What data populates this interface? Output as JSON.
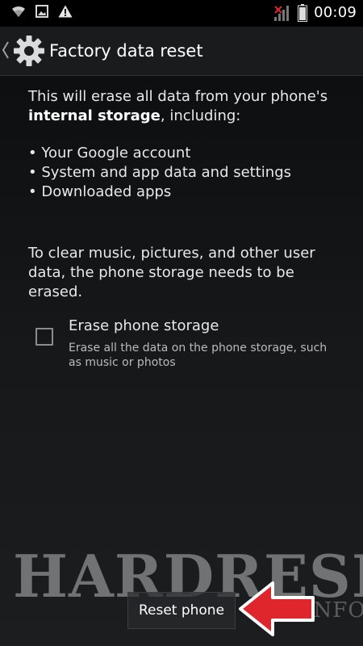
{
  "status_bar": {
    "time": "00:09",
    "icons": [
      "wifi-icon",
      "image-icon",
      "warning-icon",
      "signal-icon",
      "battery-icon"
    ]
  },
  "action_bar": {
    "icon": "settings-gear-icon",
    "title": "Factory data reset"
  },
  "content": {
    "intro_prefix": "This will erase all data from your phone's",
    "intro_bold": "internal storage",
    "intro_suffix": ", including:",
    "items": [
      "• Your Google account",
      "• System and app data and settings",
      "• Downloaded apps"
    ],
    "clear_note": "To clear music, pictures, and other user data, the phone storage needs to be erased."
  },
  "erase_option": {
    "title": "Erase phone storage",
    "summary": "Erase all the data on the phone storage, such as music or photos",
    "checked": false
  },
  "reset_button": {
    "label": "Reset phone"
  },
  "watermark": {
    "main": "HARDRESET",
    "sub": ".INFO"
  },
  "colors": {
    "arrow": "#e0262d",
    "background": "#141618",
    "text": "#e8e8e8"
  }
}
